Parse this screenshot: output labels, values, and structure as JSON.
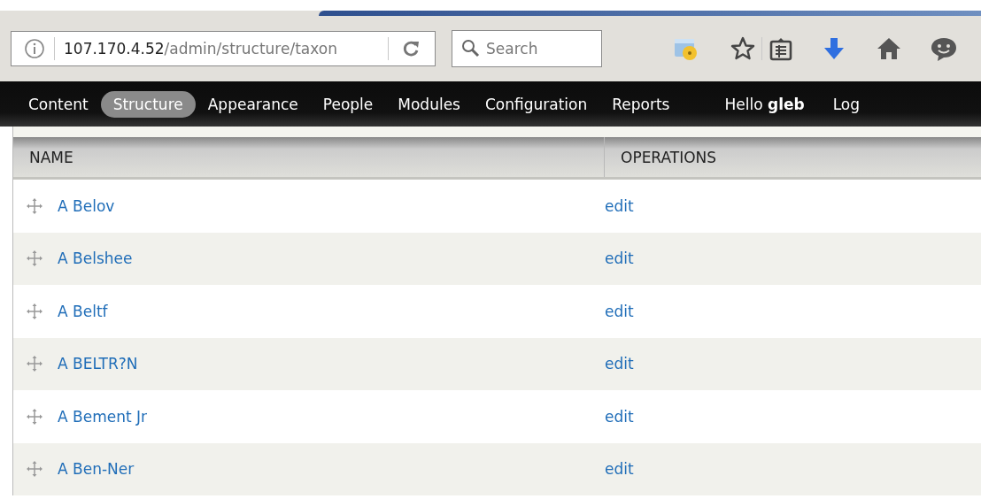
{
  "address_bar": {
    "host": "107.170.4.52",
    "path": "/admin/structure/taxon"
  },
  "search": {
    "placeholder": "Search"
  },
  "nav": [
    {
      "label": "Content",
      "selected": false
    },
    {
      "label": "Structure",
      "selected": true
    },
    {
      "label": "Appearance",
      "selected": false
    },
    {
      "label": "People",
      "selected": false
    },
    {
      "label": "Modules",
      "selected": false
    },
    {
      "label": "Configuration",
      "selected": false
    },
    {
      "label": "Reports",
      "selected": false
    }
  ],
  "user_links": [
    "Hello **gleb**",
    "Log"
  ],
  "table": {
    "columns": [
      "NAME",
      "OPERATIONS"
    ],
    "rows": [
      {
        "name": "A Belov",
        "operation": "edit"
      },
      {
        "name": "A Belshee",
        "operation": "edit"
      },
      {
        "name": "A Beltf",
        "operation": "edit"
      },
      {
        "name": "A BELTR?N",
        "operation": "edit"
      },
      {
        "name": "A Bement Jr",
        "operation": "edit"
      },
      {
        "name": "A Ben-Ner",
        "operation": "edit"
      }
    ]
  }
}
